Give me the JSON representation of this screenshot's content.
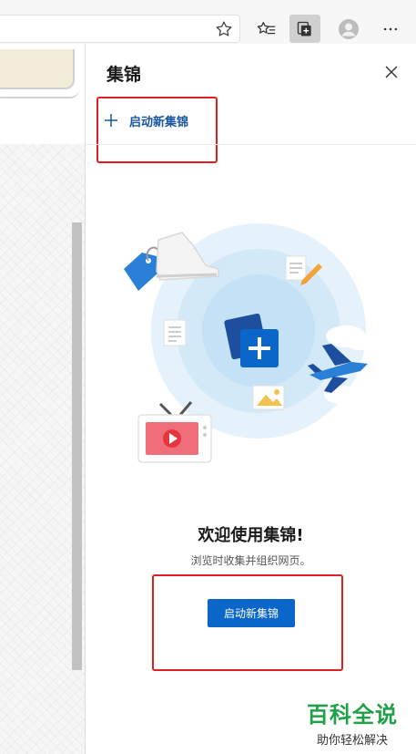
{
  "panel": {
    "title": "集锦",
    "start_new_label": "启动新集锦",
    "welcome_title": "欢迎使用集锦!",
    "welcome_subtitle": "浏览时收集并组织网页。",
    "cta_label": "启动新集锦"
  },
  "watermark": {
    "main": "百科全说",
    "sub": "助你轻松解决"
  },
  "colors": {
    "accent": "#0a66c8",
    "highlight_box": "#e02020",
    "watermark": "#21a04a"
  },
  "icons": [
    "star-icon",
    "favorites-icon",
    "collections-icon",
    "profile-icon",
    "more-icon",
    "close-icon",
    "plus-icon"
  ]
}
